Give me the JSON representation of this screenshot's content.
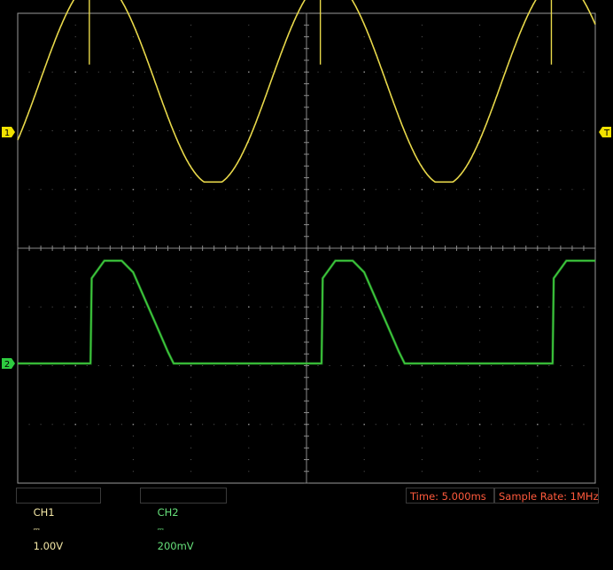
{
  "screen": {
    "background": "#000000",
    "grid_color": "#8a8a8a",
    "frame_color": "#9a9a9a",
    "divisions_x": 10,
    "divisions_y": 8
  },
  "markers": {
    "ch1_label": "1",
    "ch2_label": "2",
    "trigger_label": "T",
    "ch1_color": "#f2e200",
    "ch2_color": "#2ecc40",
    "trigger_color": "#f2e200"
  },
  "status": {
    "ch1_name": "CH1",
    "ch1_coupling": "⎓",
    "ch1_scale": "1.00V",
    "ch2_name": "CH2",
    "ch2_coupling": "⎓",
    "ch2_scale": "200mV",
    "time_label": "Time: 5.000ms",
    "rate_label": "Sample Rate: 1MHz"
  },
  "chart_data": [
    {
      "type": "line",
      "name": "CH1",
      "color": "#e8d84a",
      "x_unit": "ms",
      "y_unit": "V",
      "period_ms": 20,
      "amplitude_v": 1.75,
      "offset_v": 0.85,
      "x_range": [
        0,
        50
      ],
      "spikes_ms": [
        6.2,
        26.2,
        46.2
      ],
      "points_x": [
        0,
        1.5,
        3,
        4.5,
        6,
        7.5,
        9,
        10.5,
        12,
        13.5,
        15,
        16.5,
        18,
        19.5,
        21,
        22.5,
        24,
        25.5,
        27,
        28.5,
        30,
        31.5,
        33,
        34.5,
        36,
        37.5,
        39,
        40.5,
        42,
        43.5,
        45,
        46.5,
        48,
        49.5,
        50
      ],
      "points_y": [
        -0.35,
        0.1,
        0.6,
        1.15,
        1.7,
        2.3,
        2.6,
        2.55,
        2.1,
        1.5,
        0.85,
        0.2,
        -0.4,
        -0.8,
        -0.85,
        -0.6,
        -0.1,
        0.45,
        1.05,
        1.6,
        2.15,
        2.55,
        2.6,
        2.25,
        1.7,
        1.05,
        0.4,
        -0.2,
        -0.75,
        -0.85,
        -0.55,
        -0.05,
        0.55,
        1.6,
        2.6
      ]
    },
    {
      "type": "line",
      "name": "CH2",
      "color": "#3cc83c",
      "x_unit": "ms",
      "y_unit": "mV",
      "x_range": [
        0,
        50
      ],
      "points_x": [
        0,
        6.3,
        6.4,
        7.5,
        9,
        10,
        11,
        12,
        13,
        13.5,
        20,
        26.3,
        26.4,
        27.5,
        29,
        30,
        31,
        32,
        33,
        33.5,
        40,
        46.3,
        46.4,
        47.5,
        49,
        50
      ],
      "points_y": [
        -470,
        -470,
        -180,
        -120,
        -120,
        -160,
        -250,
        -340,
        -430,
        -470,
        -470,
        -470,
        -180,
        -120,
        -120,
        -160,
        -250,
        -340,
        -430,
        -470,
        -470,
        -470,
        -180,
        -120,
        -120,
        -120
      ]
    }
  ]
}
